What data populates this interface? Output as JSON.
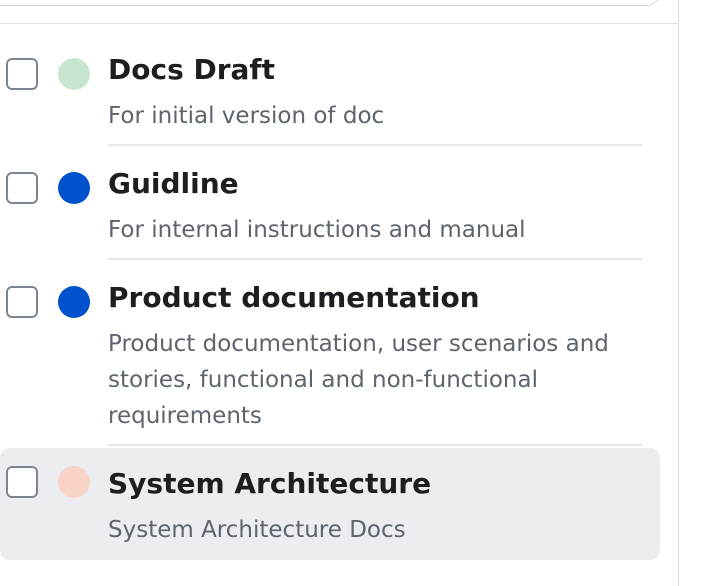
{
  "categories": [
    {
      "title": "Docs Draft",
      "description": "For initial version of doc",
      "color": "#c8e6cf"
    },
    {
      "title": "Guidline",
      "description": "For internal instructions and manual",
      "color": "#0052cc"
    },
    {
      "title": "Product documentation",
      "description": "Product documentation, user scenarios and stories, functional and non-functional requirements",
      "color": "#0052cc"
    },
    {
      "title": "System Architecture",
      "description": "System Architecture Docs",
      "color": "#f9d3c8"
    }
  ]
}
